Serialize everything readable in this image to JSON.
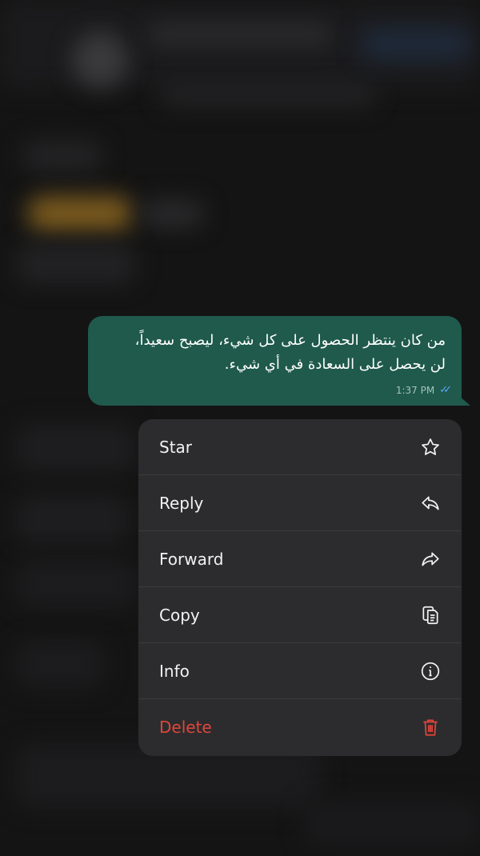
{
  "message": {
    "text": "من كان ينتظر الحصول على كل شيء، ليصبح سعيداً،\nلن يحصل على السعادة في أي شيء.",
    "time": "1:37 PM",
    "read_receipt": "double-check-icon",
    "bubble_color": "#1f5a4c",
    "ticks_color": "#5aa7ff"
  },
  "menu": {
    "items": [
      {
        "label": "Star",
        "icon": "star-icon"
      },
      {
        "label": "Reply",
        "icon": "reply-icon"
      },
      {
        "label": "Forward",
        "icon": "forward-icon"
      },
      {
        "label": "Copy",
        "icon": "copy-icon"
      },
      {
        "label": "Info",
        "icon": "info-icon"
      },
      {
        "label": "Delete",
        "icon": "trash-icon",
        "color": "#e0463b"
      }
    ]
  }
}
